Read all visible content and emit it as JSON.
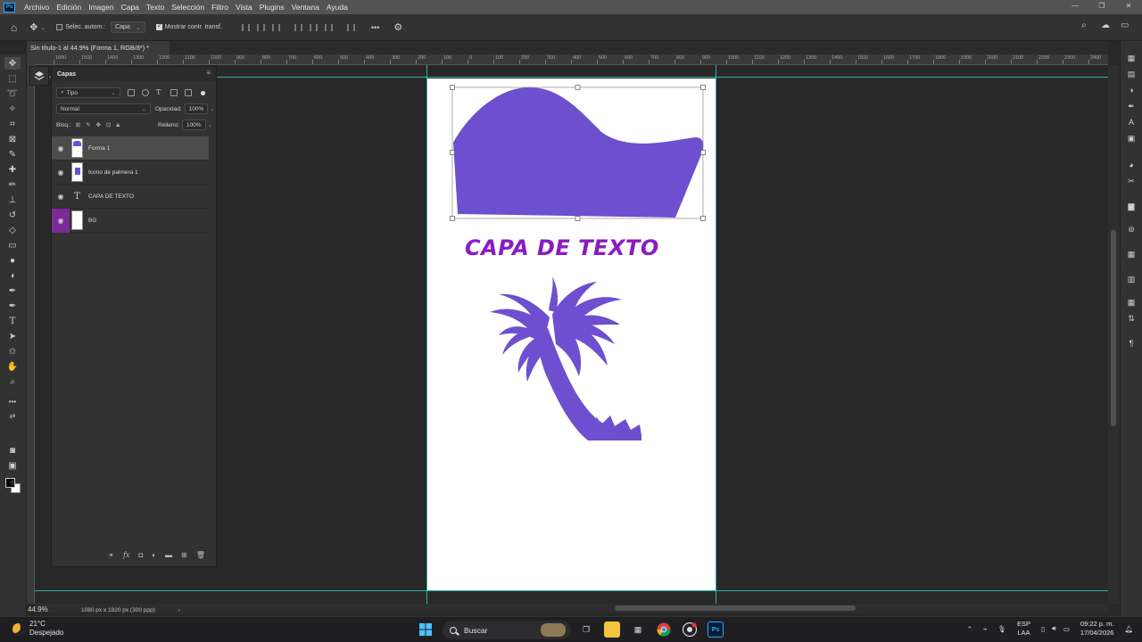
{
  "app": {
    "logo": "Ps"
  },
  "menu": [
    "Archivo",
    "Edición",
    "Imagen",
    "Capa",
    "Texto",
    "Selección",
    "Filtro",
    "Vista",
    "Plugins",
    "Ventana",
    "Ayuda"
  ],
  "options": {
    "auto_select_label": "Selec. autom.:",
    "auto_select_value": "Capa",
    "show_transform_label": "Mostrar contr. transf.",
    "more": "•••"
  },
  "document": {
    "tab_title": "Sin título-1 al 44.9% (Forma 1, RGB/8*) *",
    "tab_close": "×",
    "zoom": "44.9%",
    "status": "1080 px x 1920 px (300 ppp)"
  },
  "ruler": {
    "labels": [
      "1600",
      "1500",
      "1400",
      "1300",
      "1200",
      "1100",
      "1000",
      "900",
      "800",
      "700",
      "600",
      "500",
      "400",
      "300",
      "200",
      "100",
      "0",
      "100",
      "200",
      "300",
      "400",
      "500",
      "600",
      "700",
      "800",
      "900",
      "1000",
      "1100",
      "1200",
      "1300",
      "1400",
      "1500",
      "1600",
      "1700",
      "1800",
      "1900",
      "2000",
      "2100",
      "2200",
      "2300",
      "2400",
      "2500"
    ]
  },
  "artboard": {
    "text_layer_content": "CAPA DE TEXTO",
    "shape_color": "#6d4fd0",
    "text_color": "#8a1bc2",
    "palm_color": "#6d4fd0"
  },
  "layers_panel": {
    "title": "Capas",
    "filter_label": "Tipo",
    "blend_mode": "Normal",
    "opacity_label": "Opacidad:",
    "opacity_value": "100%",
    "lock_label": "Bloq.:",
    "fill_label": "Relleno:",
    "fill_value": "100%",
    "layers": [
      {
        "name": "Forma 1",
        "kind": "shape",
        "selected": true
      },
      {
        "name": "Icono de palmera 1",
        "kind": "smart-object",
        "selected": false
      },
      {
        "name": "CAPA DE TEXTO",
        "kind": "text",
        "selected": false
      },
      {
        "name": "BG",
        "kind": "fill",
        "selected": false
      }
    ]
  },
  "taskbar": {
    "weather_temp": "21°C",
    "weather_desc": "Despejado",
    "search_placeholder": "Buscar",
    "lang_top": "ESP",
    "lang_bottom": "LAA",
    "time": "09:22 p. m.",
    "date": "17/04/2026"
  }
}
